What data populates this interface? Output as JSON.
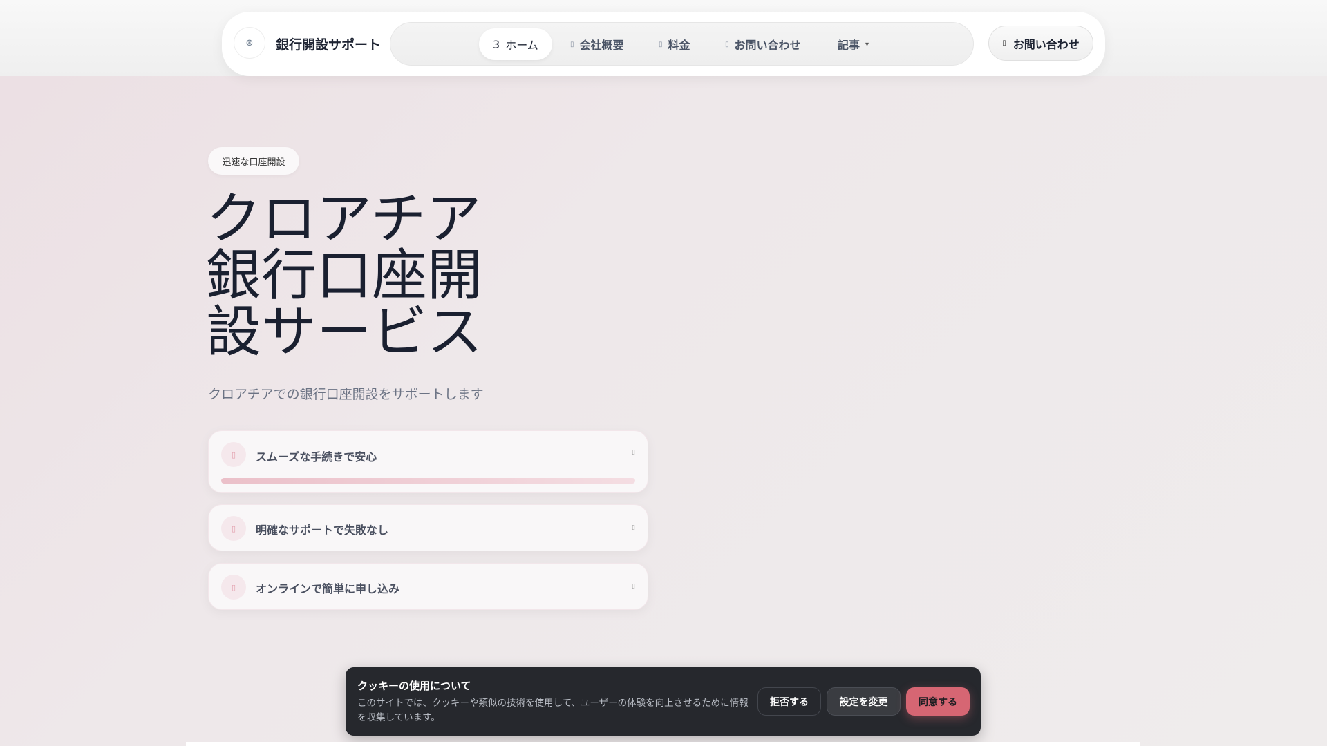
{
  "header": {
    "brand": "銀行開設サポート",
    "logo_icon": "bank-icon",
    "nav": [
      {
        "icon": "3",
        "label": "ホーム",
        "active": true
      },
      {
        "icon": "▯",
        "label": "会社概要"
      },
      {
        "icon": "▯",
        "label": "料金"
      },
      {
        "icon": "▯",
        "label": "お問い合わせ"
      },
      {
        "label": "記事",
        "dropdown": "▾"
      }
    ],
    "cta": {
      "icon": "▯",
      "label": "お問い合わせ"
    }
  },
  "hero": {
    "badge": "迅速な口座開設",
    "title_lines": [
      "クロアチア",
      "銀行口座開",
      "設サービス"
    ],
    "subtitle": "クロアチアでの銀行口座開設をサポートします",
    "features": [
      {
        "icon": "▯",
        "label": "スムーズな手続きで安心",
        "chevron": "▯",
        "expanded": true,
        "progress": 1.0
      },
      {
        "icon": "▯",
        "label": "明確なサポートで失敗なし",
        "chevron": "▯"
      },
      {
        "icon": "▯",
        "label": "オンラインで簡単に申し込み",
        "chevron": "▯"
      }
    ]
  },
  "cookie": {
    "title": "クッキーの使用について",
    "text": "このサイトでは、クッキーや類似の技術を使用して、ユーザーの体験を向上させるために情報を収集しています。",
    "reject": "拒否する",
    "settings": "設定を変更",
    "accept": "同意する",
    "accent": "#d66673"
  }
}
